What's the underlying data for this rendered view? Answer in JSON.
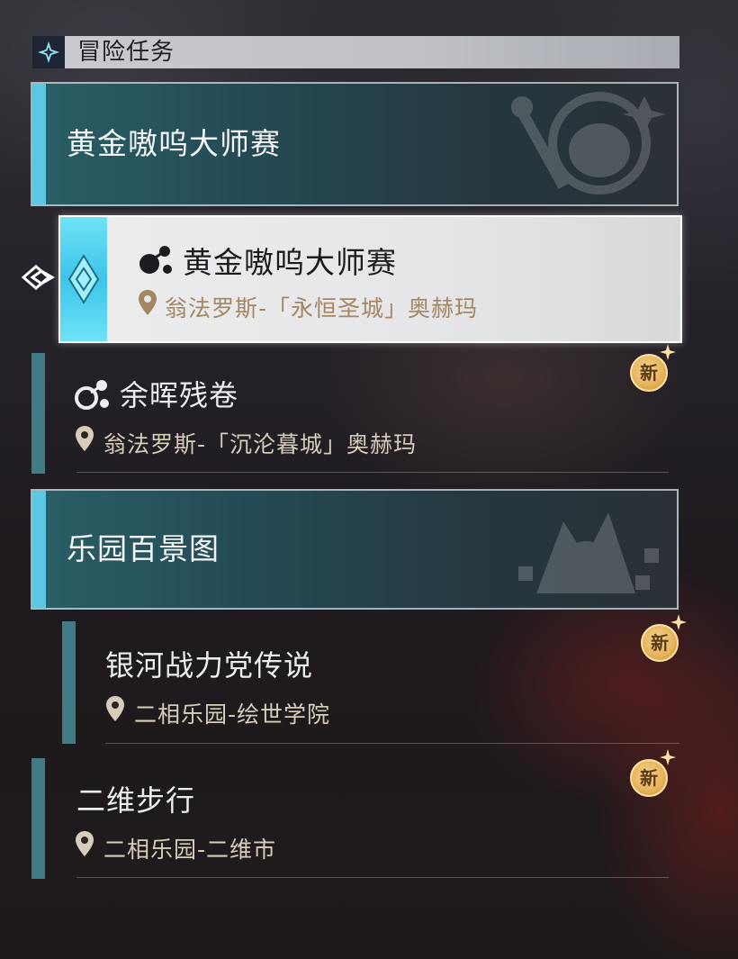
{
  "header": {
    "title": "冒险任务",
    "icon": "sparkle-icon"
  },
  "groups": [
    {
      "title": "黄金嗷呜大师赛",
      "emblem": "mascot-emblem"
    },
    {
      "title": "乐园百景图",
      "emblem": "monster-emblem"
    }
  ],
  "selected_quest": {
    "title": "黄金嗷呜大师赛",
    "location": "翁法罗斯-「永恒圣城」奥赫玛",
    "icon": "quest-type-icon"
  },
  "quests": [
    {
      "title": "余晖残卷",
      "location": "翁法罗斯-「沉沦暮城」奥赫玛",
      "badge": "新",
      "icon": "quest-type-icon"
    },
    {
      "title": "银河战力党传说",
      "location": "二相乐园-绘世学院",
      "badge": "新"
    },
    {
      "title": "二维步行",
      "location": "二相乐园-二维市",
      "badge": "新"
    }
  ],
  "colors": {
    "accent": "#5cc7e3",
    "quest_bar": "#3f7c86",
    "location_text": "#a48663",
    "badge": "#e6b25a"
  }
}
